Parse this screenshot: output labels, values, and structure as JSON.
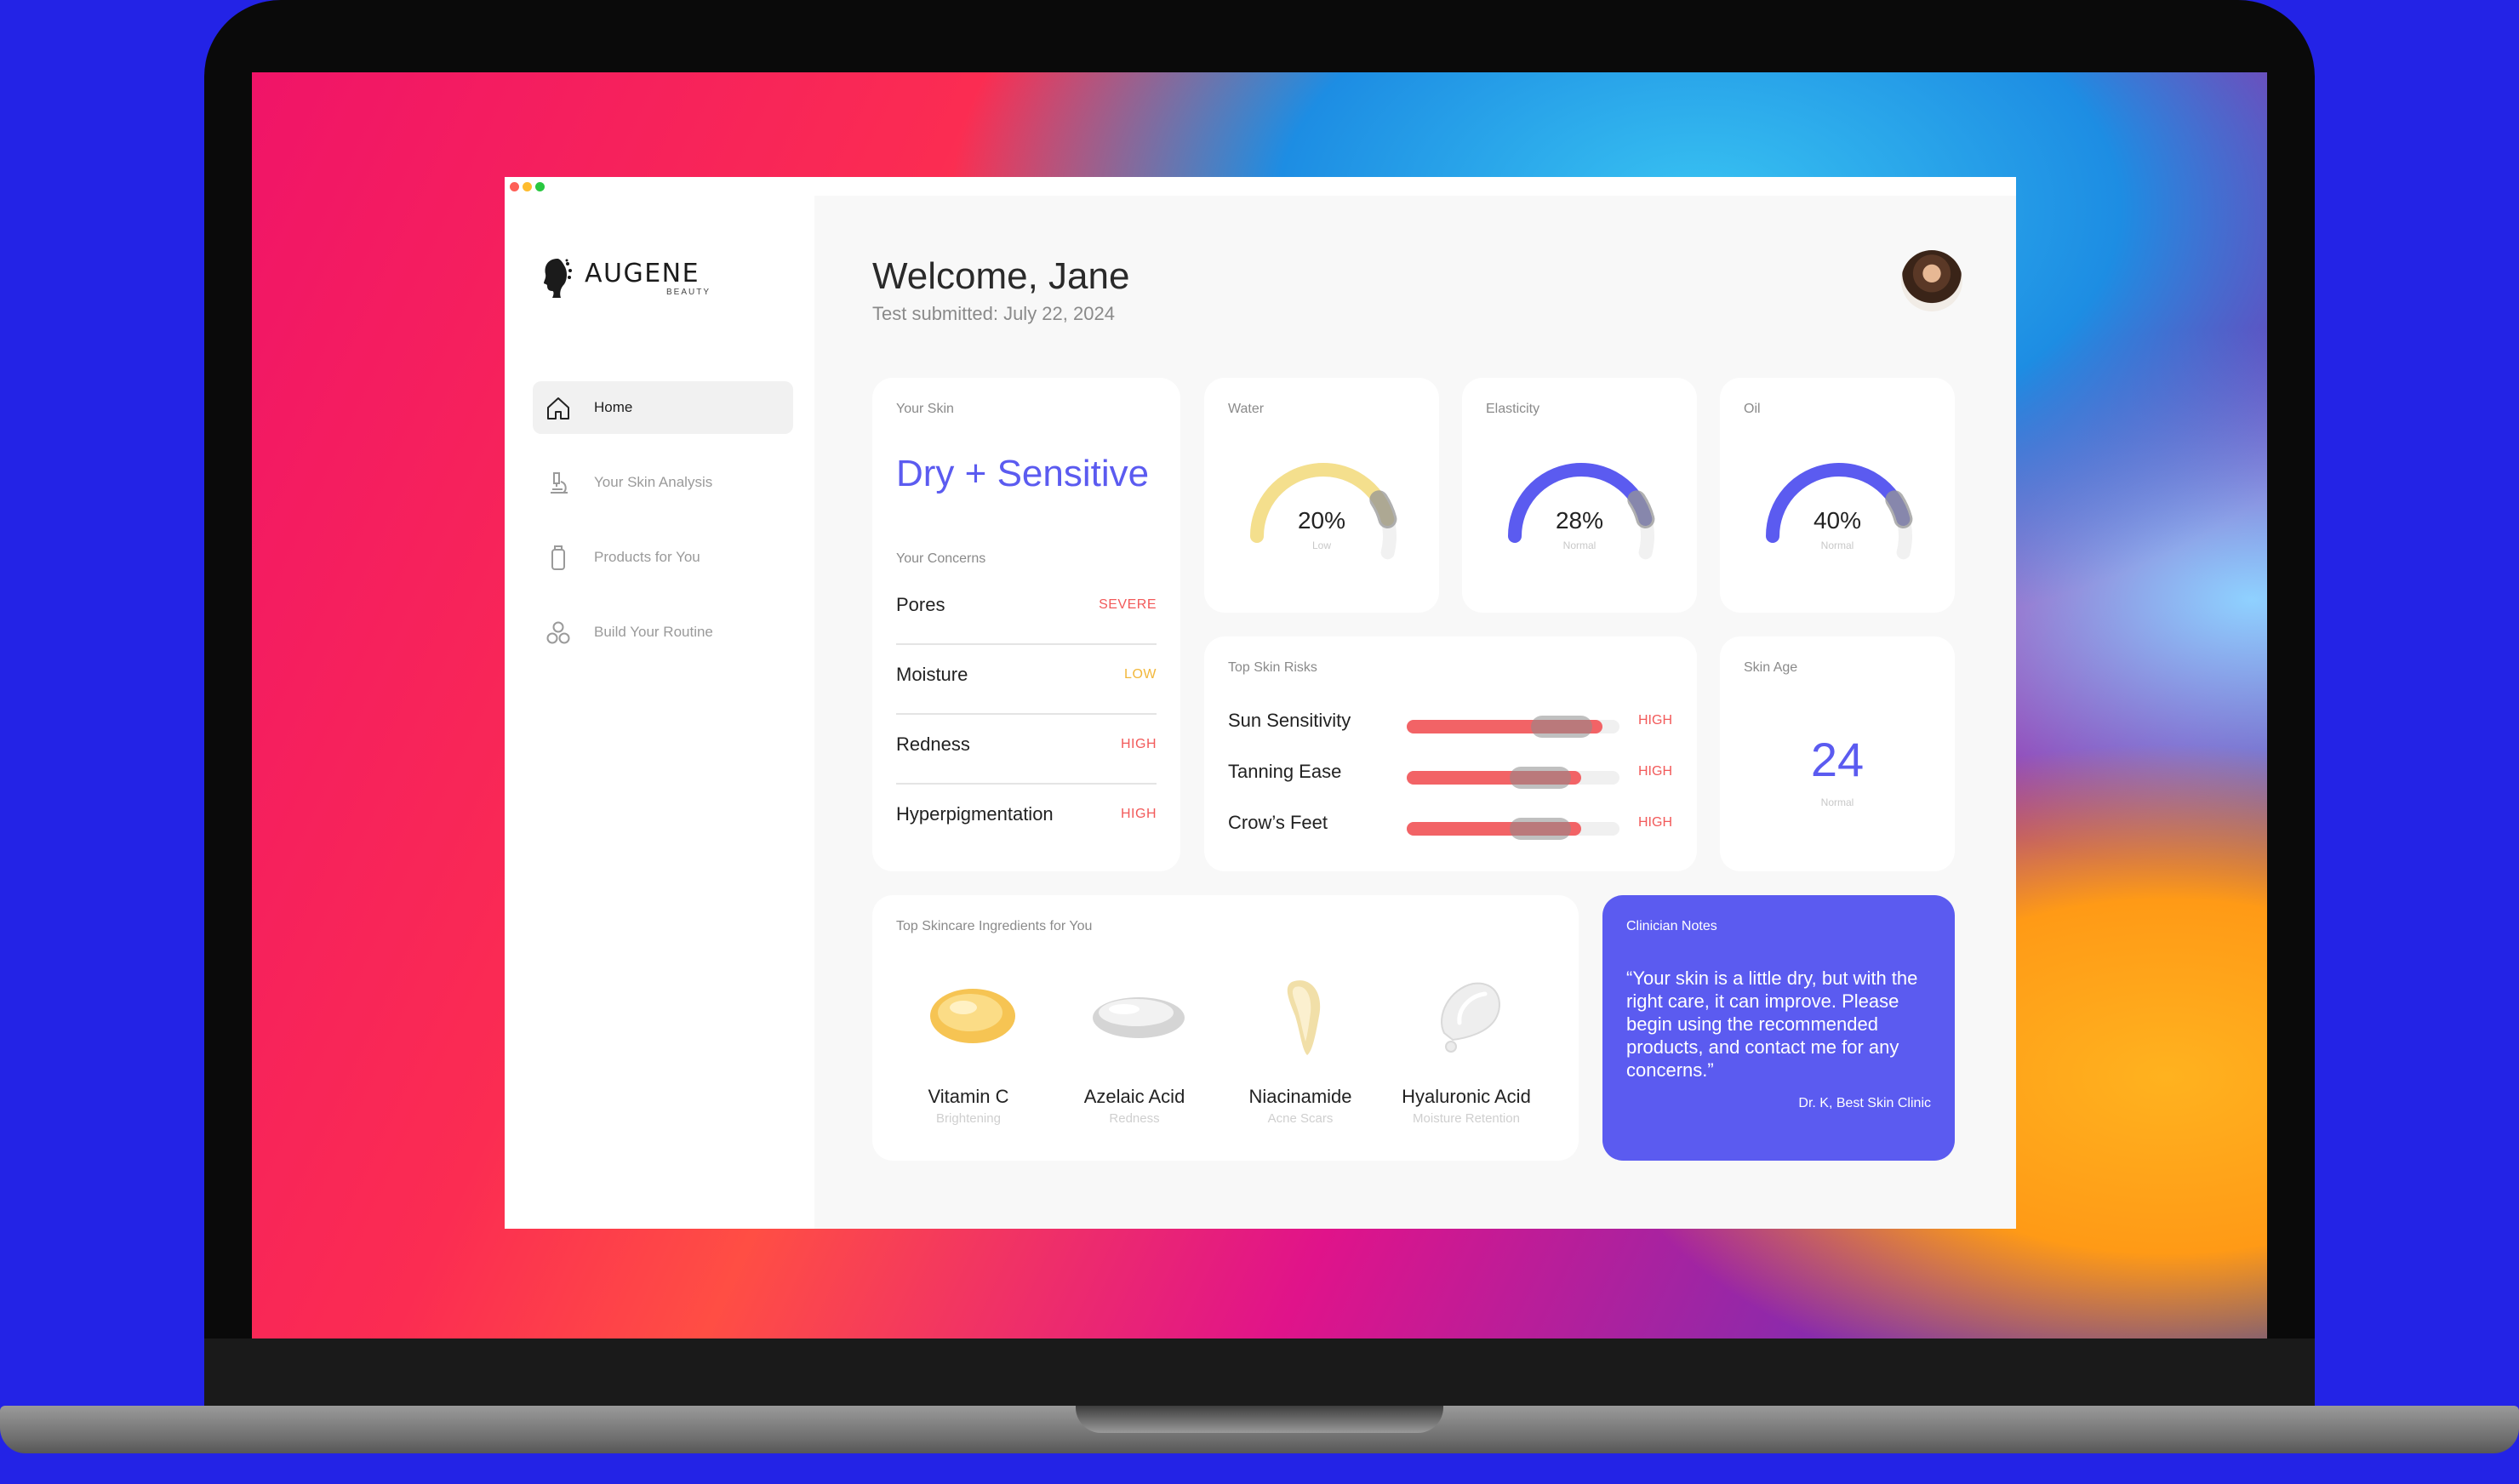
{
  "app": {
    "brand": "AUGENE",
    "brand_sub": "BEAUTY"
  },
  "sidebar": {
    "items": [
      {
        "label": "Home",
        "icon": "home-icon"
      },
      {
        "label": "Your Skin Analysis",
        "icon": "microscope-icon"
      },
      {
        "label": "Products for You",
        "icon": "bottle-icon"
      },
      {
        "label": "Build Your Routine",
        "icon": "circles-icon"
      }
    ]
  },
  "header": {
    "welcome": "Welcome, Jane",
    "submitted": "Test submitted: July 22, 2024"
  },
  "your_skin": {
    "title": "Your Skin",
    "type": "Dry + Sensitive",
    "concerns_title": "Your Concerns",
    "concerns": [
      {
        "name": "Pores",
        "level": "SEVERE",
        "color": "#f25a5a"
      },
      {
        "name": "Moisture",
        "level": "LOW",
        "color": "#f2b73a"
      },
      {
        "name": "Redness",
        "level": "HIGH",
        "color": "#f25a5a"
      },
      {
        "name": "Hyperpigmentation",
        "level": "HIGH",
        "color": "#f25a5a"
      }
    ]
  },
  "gauges": [
    {
      "title": "Water",
      "value": "20%",
      "status": "Low",
      "fraction": 0.85,
      "color": "#f4df8d"
    },
    {
      "title": "Elasticity",
      "value": "28%",
      "status": "Normal",
      "fraction": 0.85,
      "color": "#5b5bf0"
    },
    {
      "title": "Oil",
      "value": "40%",
      "status": "Normal",
      "fraction": 0.85,
      "color": "#5b5bf0"
    }
  ],
  "risks": {
    "title": "Top Skin Risks",
    "items": [
      {
        "name": "Sun Sensitivity",
        "level": "HIGH",
        "fill": 0.92
      },
      {
        "name": "Tanning Ease",
        "level": "HIGH",
        "fill": 0.82
      },
      {
        "name": "Crow’s Feet",
        "level": "HIGH",
        "fill": 0.82
      }
    ]
  },
  "skin_age": {
    "title": "Skin Age",
    "value": "24",
    "status": "Normal"
  },
  "ingredients": {
    "title": "Top Skincare Ingredients for You",
    "items": [
      {
        "name": "Vitamin C",
        "benefit": "Brightening"
      },
      {
        "name": "Azelaic Acid",
        "benefit": "Redness"
      },
      {
        "name": "Niacinamide",
        "benefit": "Acne Scars"
      },
      {
        "name": "Hyaluronic Acid",
        "benefit": "Moisture Retention"
      }
    ]
  },
  "notes": {
    "title": "Clinician Notes",
    "text": "“Your skin is a little dry, but with the right care, it can improve. Please begin using the recommended products, and contact me for any concerns.”",
    "signature": "Dr. K, Best Skin Clinic"
  },
  "colors": {
    "accent": "#5b5bf0",
    "danger": "#f25a5a",
    "warning": "#f2b73a"
  }
}
